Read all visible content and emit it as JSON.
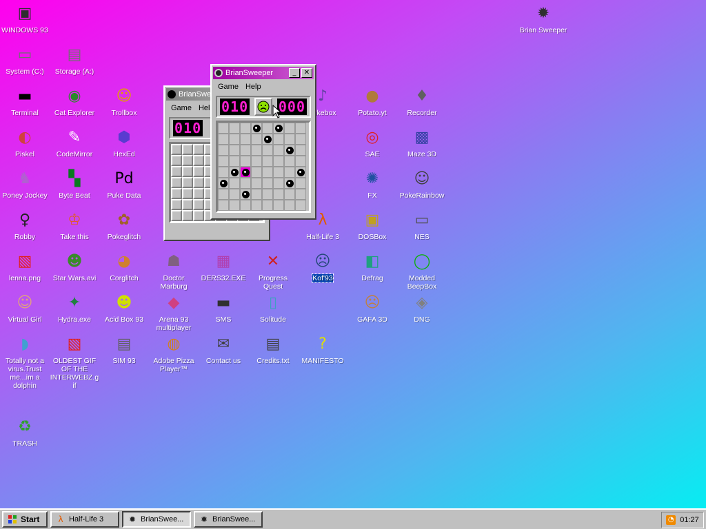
{
  "desktop": {
    "icons": [
      {
        "label": "WINDOWS 93",
        "x": 0,
        "y": 0,
        "glyph": "▣",
        "color": "#2e2e2e",
        "icon": "computer-icon"
      },
      {
        "label": "System (C:)",
        "x": 0,
        "y": 1,
        "glyph": "▭",
        "color": "#707070",
        "icon": "drive-icon"
      },
      {
        "label": "Storage (A:)",
        "x": 1,
        "y": 1,
        "glyph": "▤",
        "color": "#707070",
        "icon": "floppy-icon"
      },
      {
        "label": "Terminal",
        "x": 0,
        "y": 2,
        "glyph": "▬",
        "color": "#000000",
        "icon": "terminal-icon"
      },
      {
        "label": "Cat Explorer",
        "x": 1,
        "y": 2,
        "glyph": "◉",
        "color": "#2a8a2a",
        "icon": "globe-cat-icon"
      },
      {
        "label": "Trollbox",
        "x": 2,
        "y": 2,
        "glyph": "☺",
        "color": "#e0a000",
        "icon": "chat-icon"
      },
      {
        "label": "Piskel",
        "x": 0,
        "y": 3,
        "glyph": "◐",
        "color": "#d04040",
        "icon": "palette-icon"
      },
      {
        "label": "CodeMirror",
        "x": 1,
        "y": 3,
        "glyph": "✎",
        "color": "#ffffff",
        "icon": "codemirror-icon"
      },
      {
        "label": "HexEd",
        "x": 2,
        "y": 3,
        "glyph": "⬢",
        "color": "#5a3bd0",
        "icon": "hex-icon"
      },
      {
        "label": "Poney Jockey",
        "x": 0,
        "y": 4,
        "glyph": "♞",
        "color": "#b060d0",
        "icon": "pony-icon"
      },
      {
        "label": "Byte Beat",
        "x": 1,
        "y": 4,
        "glyph": "▚",
        "color": "#0a7a20",
        "icon": "bytebeat-icon"
      },
      {
        "label": "Puke Data",
        "x": 2,
        "y": 4,
        "glyph": "Pd",
        "color": "#000000",
        "icon": "puredata-icon"
      },
      {
        "label": "Robby",
        "x": 0,
        "y": 5,
        "glyph": "♀",
        "color": "#222222",
        "icon": "stickman-icon"
      },
      {
        "label": "Take this",
        "x": 1,
        "y": 5,
        "glyph": "♔",
        "color": "#e05a2a",
        "icon": "oldman-icon"
      },
      {
        "label": "Pokeglitch",
        "x": 2,
        "y": 5,
        "glyph": "✿",
        "color": "#a0602a",
        "icon": "pokeglitch-icon"
      },
      {
        "label": "lenna.png",
        "x": 0,
        "y": 6,
        "glyph": "▧",
        "color": "#e02020",
        "icon": "image-file-icon"
      },
      {
        "label": "Star Wars.avi",
        "x": 1,
        "y": 6,
        "glyph": "☻",
        "color": "#3a8a2a",
        "icon": "yoda-icon"
      },
      {
        "label": "Corglitch",
        "x": 2,
        "y": 6,
        "glyph": "◕",
        "color": "#d08030",
        "icon": "corgi-icon"
      },
      {
        "label": "Doctor Marburg",
        "x": 3,
        "y": 6,
        "glyph": "☗",
        "color": "#806080",
        "icon": "doctor-icon"
      },
      {
        "label": "DERS32.EXE",
        "x": 4,
        "y": 6,
        "glyph": "▦",
        "color": "#b040b0",
        "icon": "ders-icon"
      },
      {
        "label": "Progress Quest",
        "x": 5,
        "y": 6,
        "glyph": "✕",
        "color": "#d02020",
        "icon": "swords-icon"
      },
      {
        "label": "Kof'93",
        "x": 6,
        "y": 6,
        "glyph": "☹",
        "color": "#3060a0",
        "icon": "kof-icon",
        "selected": true
      },
      {
        "label": "Defrag",
        "x": 7,
        "y": 6,
        "glyph": "◧",
        "color": "#20a080",
        "icon": "defrag-icon"
      },
      {
        "label": "Modded BeepBox",
        "x": 8,
        "y": 6,
        "glyph": "◯",
        "color": "#10b010",
        "icon": "beepbox-icon"
      },
      {
        "label": "Virtual Girl",
        "x": 0,
        "y": 7,
        "glyph": "☺",
        "color": "#e0a080",
        "icon": "face-icon"
      },
      {
        "label": "Hydra.exe",
        "x": 1,
        "y": 7,
        "glyph": "✦",
        "color": "#208040",
        "icon": "hydra-icon"
      },
      {
        "label": "Acid Box 93",
        "x": 2,
        "y": 7,
        "glyph": "☻",
        "color": "#d0e000",
        "icon": "acid-smiley-icon"
      },
      {
        "label": "Arena 93 multiplayer",
        "x": 3,
        "y": 7,
        "glyph": "◆",
        "color": "#d04080",
        "icon": "cube-icon"
      },
      {
        "label": "SMS",
        "x": 4,
        "y": 7,
        "glyph": "▬",
        "color": "#303030",
        "icon": "sms-icon"
      },
      {
        "label": "Solitude",
        "x": 5,
        "y": 7,
        "glyph": "▯",
        "color": "#40a0c0",
        "icon": "jar-icon"
      },
      {
        "label": "GAFA 3D",
        "x": 7,
        "y": 7,
        "glyph": "☹",
        "color": "#c08040",
        "icon": "gafa-face-icon"
      },
      {
        "label": "DNG",
        "x": 8,
        "y": 7,
        "glyph": "◈",
        "color": "#808080",
        "icon": "dng-icon"
      },
      {
        "label": "Totally not a virus.Trust me...im a dolphin",
        "x": 0,
        "y": 8,
        "glyph": "◗",
        "color": "#40a0d0",
        "icon": "dolphin-icon"
      },
      {
        "label": "OLDEST GIF OF THE INTERWEBZ.gif",
        "x": 1,
        "y": 8,
        "glyph": "▧",
        "color": "#e02020",
        "icon": "gif-file-icon"
      },
      {
        "label": "SIM 93",
        "x": 2,
        "y": 8,
        "glyph": "▤",
        "color": "#606060",
        "icon": "sim-icon"
      },
      {
        "label": "Adobe Pizza Player™",
        "x": 3,
        "y": 8,
        "glyph": "◍",
        "color": "#d08020",
        "icon": "pizza-icon"
      },
      {
        "label": "Contact us",
        "x": 4,
        "y": 8,
        "glyph": "✉",
        "color": "#404040",
        "icon": "contact-icon"
      },
      {
        "label": "Credits.txt",
        "x": 5,
        "y": 8,
        "glyph": "▤",
        "color": "#404040",
        "icon": "text-file-icon"
      },
      {
        "label": "MANIFESTO",
        "x": 6,
        "y": 8,
        "glyph": "?",
        "color": "#e0e000",
        "icon": "question-icon"
      },
      {
        "label": "TRASH",
        "x": 0,
        "y": 10,
        "glyph": "♻",
        "color": "#30a030",
        "icon": "trash-icon"
      },
      {
        "label": "Jukebox",
        "x": 6,
        "y": 2,
        "glyph": "♪",
        "color": "#6040a0",
        "icon": "jukebox-icon"
      },
      {
        "label": "Potato.yt",
        "x": 7,
        "y": 2,
        "glyph": "●",
        "color": "#b07a3a",
        "icon": "potato-icon"
      },
      {
        "label": "Recorder",
        "x": 8,
        "y": 2,
        "glyph": "♦",
        "color": "#606060",
        "icon": "microphone-icon"
      },
      {
        "label": "SAE",
        "x": 7,
        "y": 3,
        "glyph": "◎",
        "color": "#e02020",
        "icon": "sae-ball-icon"
      },
      {
        "label": "Maze 3D",
        "x": 8,
        "y": 3,
        "glyph": "▩",
        "color": "#3040a0",
        "icon": "maze-icon"
      },
      {
        "label": "FX",
        "x": 7,
        "y": 4,
        "glyph": "✺",
        "color": "#2050a0",
        "icon": "fx-icon"
      },
      {
        "label": "PokeRainbow",
        "x": 8,
        "y": 4,
        "glyph": "☺",
        "color": "#404040",
        "icon": "pokerainbow-icon"
      },
      {
        "label": "Half-Life 3",
        "x": 6,
        "y": 5,
        "glyph": "λ",
        "color": "#e05a00",
        "icon": "halflife-icon"
      },
      {
        "label": "DOSBox",
        "x": 7,
        "y": 5,
        "glyph": "▣",
        "color": "#c0a020",
        "icon": "dosbox-icon"
      },
      {
        "label": "NES",
        "x": 8,
        "y": 5,
        "glyph": "▭",
        "color": "#505050",
        "icon": "nes-icon"
      },
      {
        "label": "Brian Sweeper",
        "x": "far",
        "y": 0,
        "glyph": "✹",
        "color": "#303030",
        "icon": "mine-icon"
      }
    ]
  },
  "window_back": {
    "title": "BrianSwe",
    "menu": [
      "Game",
      "Help"
    ],
    "counter": "010"
  },
  "window_front": {
    "title": "BrianSweeper",
    "menu": [
      "Game",
      "Help"
    ],
    "mines_left": "010",
    "timer": "000",
    "face": "sad",
    "rows": 8,
    "cols": 8,
    "mines": [
      [
        0,
        3
      ],
      [
        0,
        5
      ],
      [
        1,
        4
      ],
      [
        2,
        6
      ],
      [
        4,
        1
      ],
      [
        4,
        7
      ],
      [
        5,
        0
      ],
      [
        5,
        6
      ],
      [
        6,
        2
      ]
    ],
    "exploded": [
      4,
      2
    ]
  },
  "taskbar": {
    "start_label": "Start",
    "buttons": [
      {
        "label": "Half-Life 3",
        "icon": "halflife-icon",
        "pressed": false
      },
      {
        "label": "BrianSwee...",
        "icon": "mine-icon",
        "pressed": true
      },
      {
        "label": "BrianSwee...",
        "icon": "mine-icon",
        "pressed": false
      }
    ],
    "clock": "01:27"
  },
  "colors": {
    "accent_title": "#a000a0",
    "lcd": "#ff1fd0",
    "exploded": "#e800d8"
  }
}
